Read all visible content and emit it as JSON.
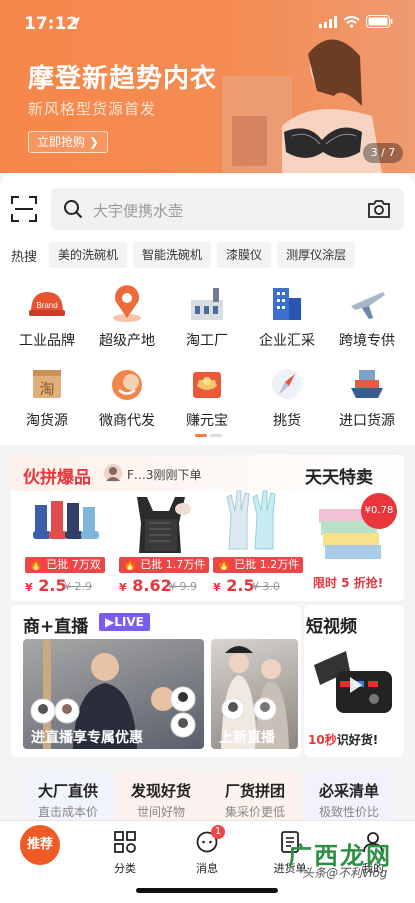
{
  "status": {
    "time": "17:12"
  },
  "banner": {
    "title": "摩登新趋势内衣",
    "subtitle": "新风格型货源首发",
    "button": "立即抢购 ❯",
    "pager": "3 / 7"
  },
  "search": {
    "placeholder": "大宇便携水壶"
  },
  "hot": {
    "label": "热搜",
    "tags": [
      "美的洗碗机",
      "智能洗碗机",
      "漆膜仪",
      "测厚仪涂层"
    ]
  },
  "categories": [
    {
      "label": "工业品牌",
      "icon": "brand-icon"
    },
    {
      "label": "超级产地",
      "icon": "location-pin-icon"
    },
    {
      "label": "淘工厂",
      "icon": "factory-icon"
    },
    {
      "label": "企业汇采",
      "icon": "building-icon"
    },
    {
      "label": "跨境专供",
      "icon": "airplane-icon"
    },
    {
      "label": "淘货源",
      "icon": "tao-box-icon"
    },
    {
      "label": "微商代发",
      "icon": "smile-bag-icon"
    },
    {
      "label": "赚元宝",
      "icon": "gold-ingot-icon"
    },
    {
      "label": "挑货",
      "icon": "compass-icon"
    },
    {
      "label": "进口货源",
      "icon": "ship-icon"
    }
  ],
  "group_buy": {
    "title": "伙拼爆品",
    "ticker": "F…3刚刚下单",
    "products": [
      {
        "badge": "已批 7万双",
        "price": "2.5",
        "old": "¥ 2.9"
      },
      {
        "badge": "已批 1.7万件",
        "price": "8.62",
        "old": "¥ 9.9"
      },
      {
        "badge": "已批 1.2万件",
        "price": "2.5",
        "old": "¥ 3.0"
      }
    ]
  },
  "daily": {
    "title": "天天特卖",
    "price_tag": "¥0.78",
    "caption": "限时 5 折抢!"
  },
  "live": {
    "title": "商+直播",
    "live_badge": "LIVE",
    "main_caption": "进直播享专属优惠",
    "side_caption": "上新直播"
  },
  "short_video": {
    "title": "短视频",
    "caption_num": "10秒",
    "caption_text": "识好货!"
  },
  "tiles": [
    {
      "title": "大厂直供",
      "sub": "直击成本价"
    },
    {
      "title": "发现好货",
      "sub": "世间好物"
    },
    {
      "title": "厂货拼团",
      "sub": "集采价更低"
    },
    {
      "title": "必采清单",
      "sub": "极致性价比"
    }
  ],
  "tabbar": {
    "recommend": "推荐",
    "tabs": [
      {
        "label": "分类",
        "icon": "category-grid-icon"
      },
      {
        "label": "消息",
        "icon": "message-icon",
        "badge": "1"
      },
      {
        "label": "进货单",
        "icon": "order-list-icon"
      },
      {
        "label": "我的",
        "icon": "user-icon"
      }
    ]
  },
  "watermark": {
    "brand": "广西龙网",
    "handle": "头条@不利vlog"
  },
  "colors": {
    "accent": "#f27b3f",
    "price": "#e8363c",
    "badge": "#ec4746",
    "live": "#7b5cf0"
  }
}
